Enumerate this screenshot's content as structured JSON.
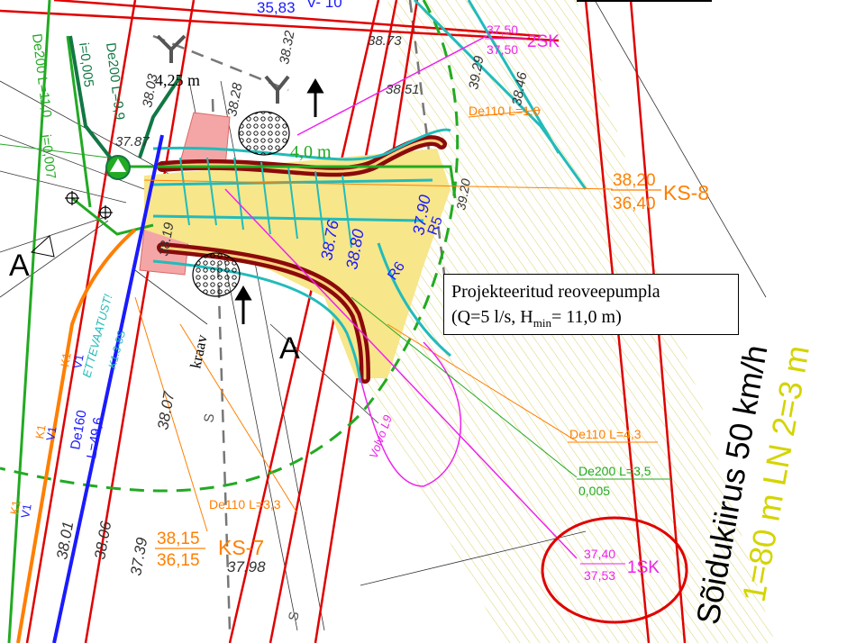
{
  "colors": {
    "red": "#e00000",
    "green": "#22aa22",
    "dark_green": "#117744",
    "teal": "#22bbbb",
    "orange": "#ff7f00",
    "magenta": "#ee22ee",
    "blue": "#1a1aff",
    "yellow_fill": "#f7e68a",
    "dark_red": "#8a0a0a",
    "pink_fill": "#f4a6a6",
    "yellow_text": "#d4d400",
    "gray": "#666666"
  },
  "labels": {
    "top_value": "35,83",
    "top_vk": "V- 10",
    "de200_left": "De200 L=11,0",
    "de200_left_slope": "i=0,007",
    "de200_l99": "De200 L=9,9",
    "de200_l99_slope": "i=0,005",
    "dim_425": "4,25 m",
    "dim_40": "4,0 m",
    "elev_3787": "37.87",
    "elev_3851": "38.51",
    "elev_3873": "38.73",
    "elev_3832": "38.32",
    "elev_3828": "38.28",
    "elev_3929": "39.29",
    "elev_3846": "38.46",
    "elev_3920": "39.20",
    "elev_3790": "37.90",
    "elev_3880": "38.80",
    "elev_3876": "38.76",
    "elev_3803": "38.03",
    "elev_3807": "38.07",
    "elev_3801": "38.01",
    "elev_3806": "38.06",
    "elev_3739": "37.39",
    "elev_3798": "37.98",
    "elev_3819": "38.19",
    "sk2_top": "37,50",
    "sk2_bottom": "37,50",
    "sk2_name": "2SK",
    "de110_top": "De110 L=1,0",
    "ks8_top": "38,20",
    "ks8_bottom": "36,40",
    "ks8_name": "KS-8",
    "section_a": "A",
    "r5": "R5",
    "r6": "R6",
    "r16": "R16",
    "ettevaatust": "ETTEVAATUST!",
    "kaabel": "K1.3-8S",
    "de160": "De160",
    "de160_len": "L=49,6",
    "kraav": "kraav",
    "volvo": "Volvo L9",
    "de110_43": "De110 L=4,3",
    "de200_35": "De200 L=3,5",
    "de200_35_slope": "0,005",
    "de110_33": "De110 L=3,3",
    "ks7_top": "38,15",
    "ks7_bottom": "36,15",
    "ks7_name": "KS-7",
    "sk1_top": "37,40",
    "sk1_bottom": "37,53",
    "sk1_name": "1SK",
    "speed": "Sõidukiirus 50 km/h",
    "sight": "1=80 m LN 2=3 m",
    "k1": "K1",
    "v1": "V1",
    "s_mark": "S"
  },
  "note": {
    "line1": "Projekteeritud reoveepumpla",
    "line2_prefix": "(Q=5 l/s, H",
    "line2_sub": "min",
    "line2_suffix": "= 11,0 m)"
  }
}
